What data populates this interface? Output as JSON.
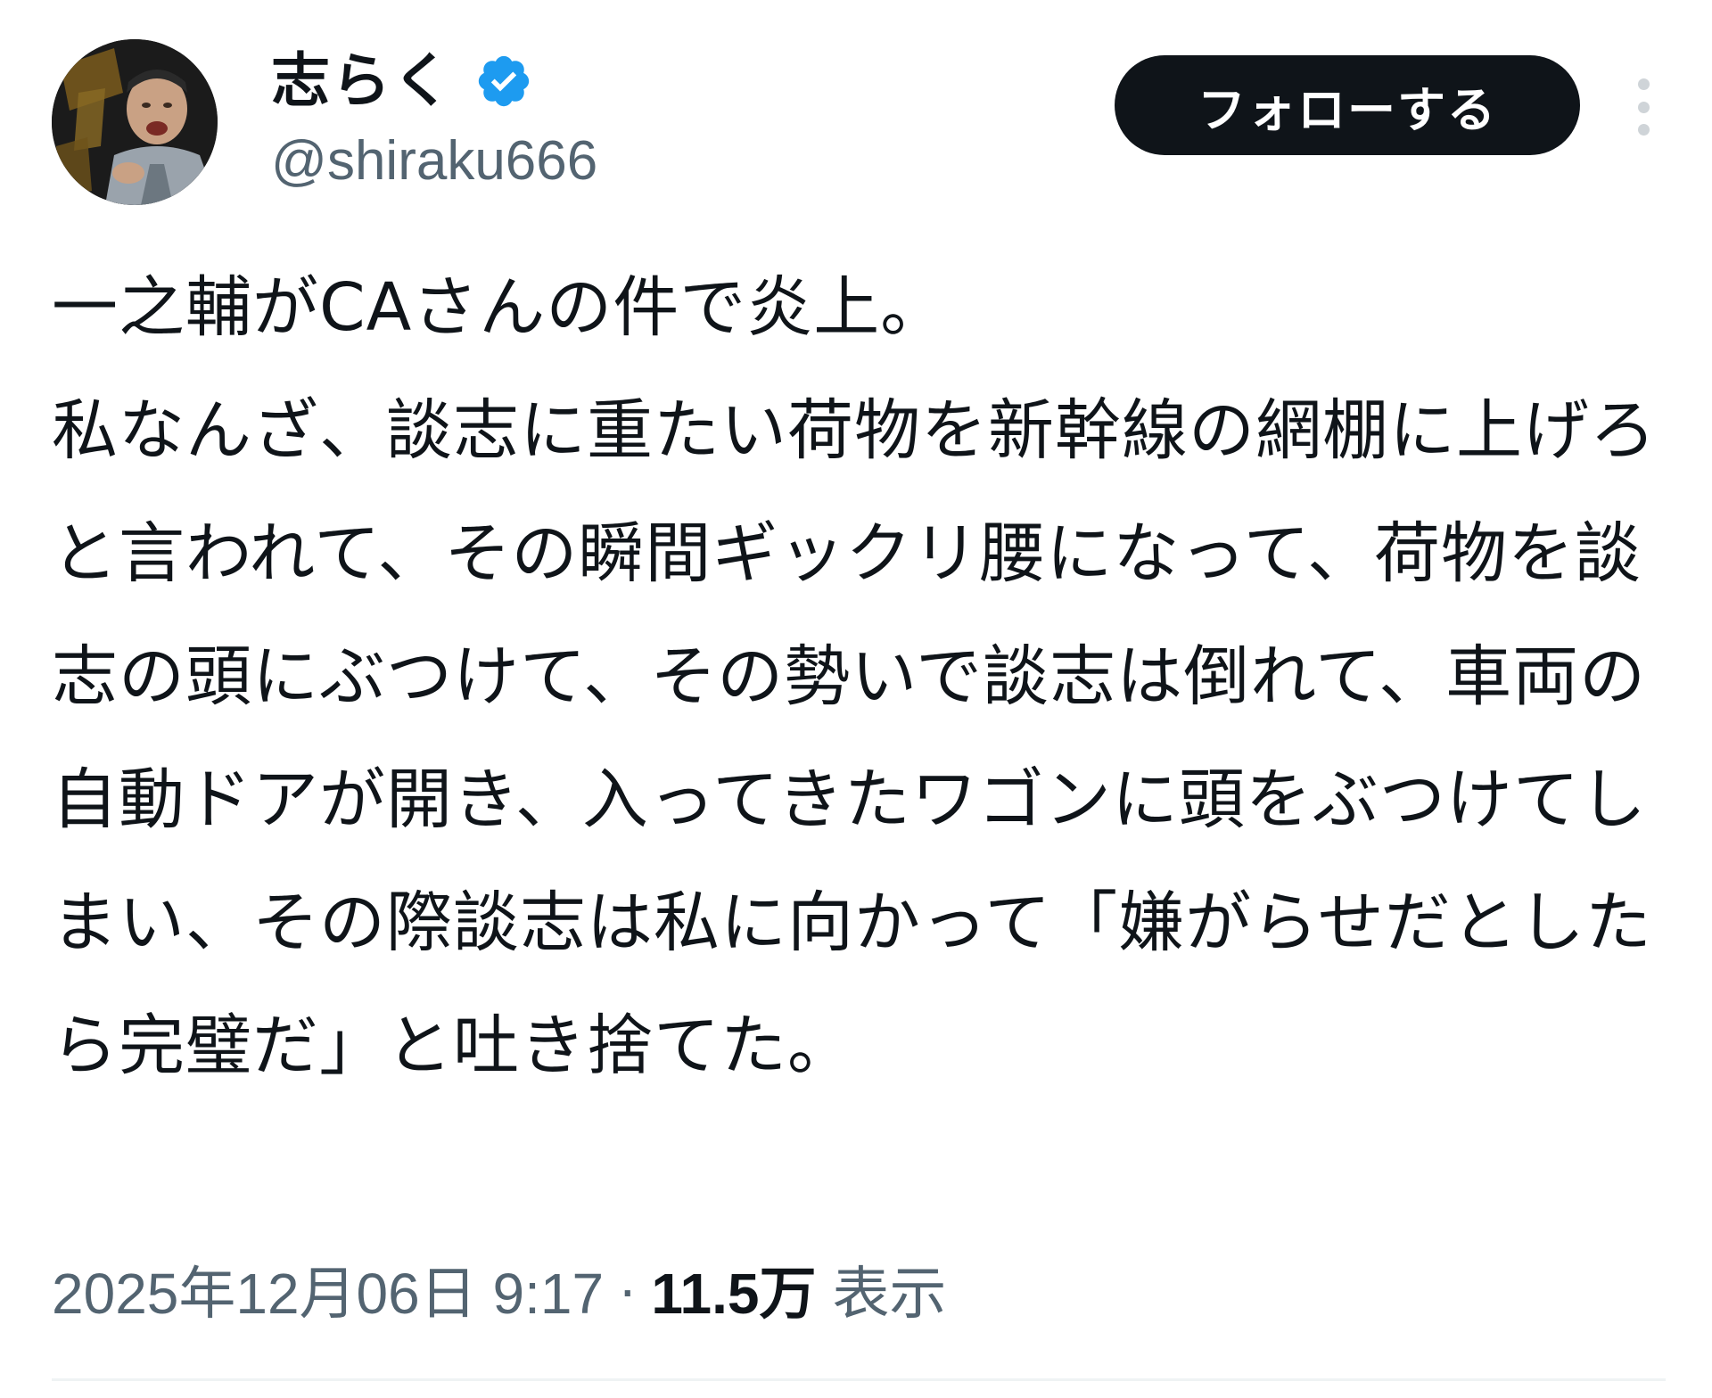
{
  "user": {
    "display_name": "志らく",
    "handle": "@shiraku666",
    "avatar_icon": "user-avatar-photo",
    "verified_icon": "verified-badge-icon",
    "verified_color": "#1d9bf0"
  },
  "actions": {
    "follow_label": "フォローする",
    "more_icon": "more-vertical-icon"
  },
  "tweet": {
    "text": "一之輔がCAさんの件で炎上。\n私なんざ、談志に重たい荷物を新幹線の網棚に上げろと言われて、その瞬間ギックリ腰になって、荷物を談志の頭にぶつけて、その勢いで談志は倒れて、車両の自動ドアが開き、入ってきたワゴンに頭をぶつけてしまい、その際談志は私に向かって「嫌がらせだとしたら完璧だ」と吐き捨てた。"
  },
  "meta": {
    "timestamp": "2025年12月06日 9:17",
    "separator": "·",
    "views_count": "11.5万",
    "views_label": "表示"
  },
  "colors": {
    "text_primary": "#0f1419",
    "text_secondary": "#536471",
    "button_bg": "#0f1419",
    "button_text": "#ffffff",
    "divider": "#eff3f4"
  }
}
